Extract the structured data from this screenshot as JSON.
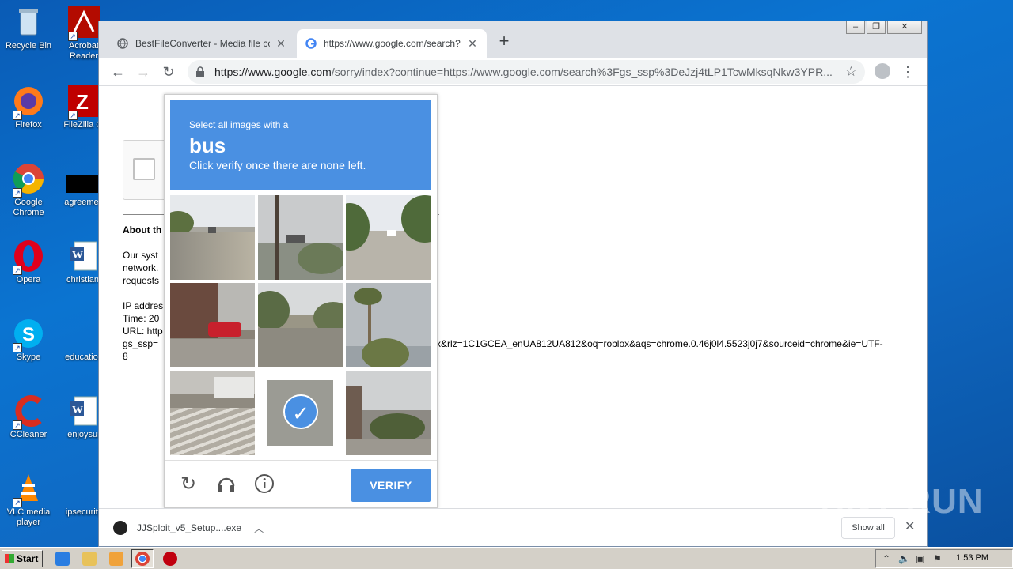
{
  "desktop": {
    "icons": [
      {
        "label": "Recycle Bin"
      },
      {
        "label": "Acrobat Reader"
      },
      {
        "label": "Firefox"
      },
      {
        "label": "FileZilla Cl"
      },
      {
        "label": "Google Chrome"
      },
      {
        "label": "agreemen"
      },
      {
        "label": "Opera"
      },
      {
        "label": "christianf"
      },
      {
        "label": "Skype"
      },
      {
        "label": "education"
      },
      {
        "label": "CCleaner"
      },
      {
        "label": "enjoysur"
      },
      {
        "label": "VLC media player"
      },
      {
        "label": "ipsecurity"
      }
    ]
  },
  "browser": {
    "tabs": [
      {
        "title": "BestFileConverter - Media file conver",
        "close": "✕"
      },
      {
        "title": "https://www.google.com/search?gs_",
        "close": "✕"
      }
    ],
    "new_tab": "+",
    "url_domain": "https://www.google.com",
    "url_rest": "/sorry/index?continue=https://www.google.com/search%3Fgs_ssp%3DeJzj4tLP1TcwMksqNkw3YPR...",
    "colors": {
      "accent": "#4a90e2"
    }
  },
  "page": {
    "about_heading": "About th",
    "para1_line1": "Our syst",
    "para1_line2": "network.",
    "para1_line3": "requests",
    "ip_line": "IP addres",
    "time_line": "Time: 20",
    "url_line": "URL: http",
    "url_cont": "gs_ssp=",
    "url_tail": "x&rlz=1C1GCEA_enUA812UA812&oq=roblox&aqs=chrome.0.46j0l4.5523j0j7&sourceid=chrome&ie=UTF-",
    "url_wrap": "8"
  },
  "captcha": {
    "instruction": "Select all images with a",
    "target": "bus",
    "hint": "Click verify once there are none left.",
    "verify_label": "VERIFY",
    "selected_tile": 7
  },
  "downloads": {
    "file": "JJSploit_v5_Setup....exe",
    "show_all": "Show all"
  },
  "watermark": "ANY RUN",
  "taskbar": {
    "start": "Start",
    "clock": "1:53 PM"
  }
}
